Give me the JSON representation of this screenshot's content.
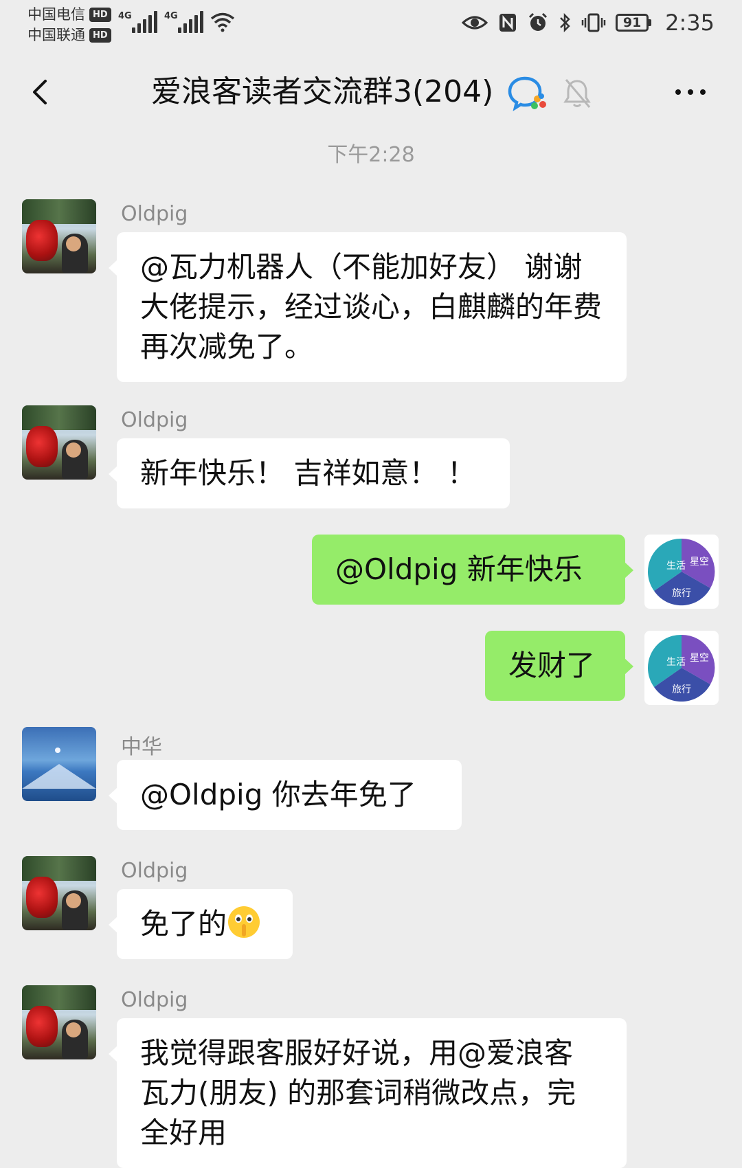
{
  "status_bar": {
    "carrier1": "中国电信",
    "carrier2": "中国联通",
    "hd_label": "HD",
    "net1": "4G",
    "net2": "4G",
    "battery": "91",
    "time": "2:35"
  },
  "nav": {
    "title": "爱浪客读者交流群3(204)"
  },
  "timestamp": "下午2:28",
  "avatar_labels": {
    "life": "生活",
    "sky": "星空",
    "travel": "旅行"
  },
  "messages": [
    {
      "side": "left",
      "sender": "Oldpig",
      "text": "@瓦力机器人（不能加好友） 谢谢大佬提示，经过谈心，白麒麟的年费再次减免了。"
    },
    {
      "side": "left",
      "sender": "Oldpig",
      "text": "新年快乐！ 吉祥如意！ ！"
    },
    {
      "side": "right",
      "text": "@Oldpig 新年快乐"
    },
    {
      "side": "right",
      "text": "发财了"
    },
    {
      "side": "left",
      "sender": "中华",
      "text": "@Oldpig 你去年免了"
    },
    {
      "side": "left",
      "sender": "Oldpig",
      "text": "免了的",
      "emoji": "shush-face"
    },
    {
      "side": "left",
      "sender": "Oldpig",
      "text": "我觉得跟客服好好说，用@爱浪客 瓦力(朋友) 的那套词稍微改点，完全好用"
    }
  ],
  "colors": {
    "background": "#ededed",
    "bubble_self": "#95ec69",
    "bubble_other": "#ffffff"
  }
}
